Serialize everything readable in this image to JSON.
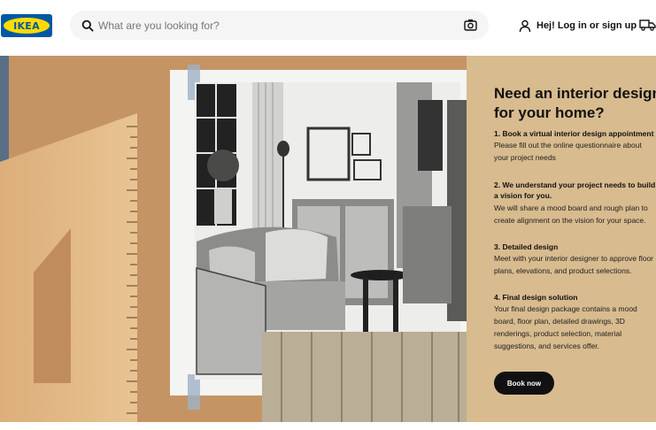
{
  "header": {
    "logo_text": "IKEA",
    "search": {
      "placeholder": "What are you looking for?"
    },
    "login_label": "Hej! Log in or sign up",
    "icons": [
      "search-icon",
      "camera-icon",
      "user-icon",
      "truck-icon"
    ]
  },
  "colors": {
    "brand_blue": "#0058a3",
    "brand_yellow": "#ffdb00",
    "panel_background": "#d8bb8e",
    "button_background": "#111111"
  },
  "panel": {
    "title_line1": "Need an interior designer",
    "title_line2": "for your home?",
    "steps": [
      {
        "title": "1. Book a virtual interior design appointment",
        "text_lines": [
          "Please fill out the online questionnaire about",
          "your project needs"
        ]
      },
      {
        "title_lines": [
          "2. We understand your project needs to build",
          "a vision for you."
        ],
        "text_lines": [
          "We will share a mood board and rough plan to",
          "create alignment on the vision for your space."
        ]
      },
      {
        "title": "3. Detailed design",
        "text_lines": [
          "Meet with your interior designer to approve floor",
          "plans, elevations, and product selections."
        ]
      },
      {
        "title": "4. Final design solution",
        "text_lines": [
          "Your final design package contains a mood",
          "board, floor plan, detailed drawings, 3D",
          "renderings, product selection, material",
          "suggestions, and services offer."
        ]
      }
    ],
    "button_label": "Book now"
  }
}
